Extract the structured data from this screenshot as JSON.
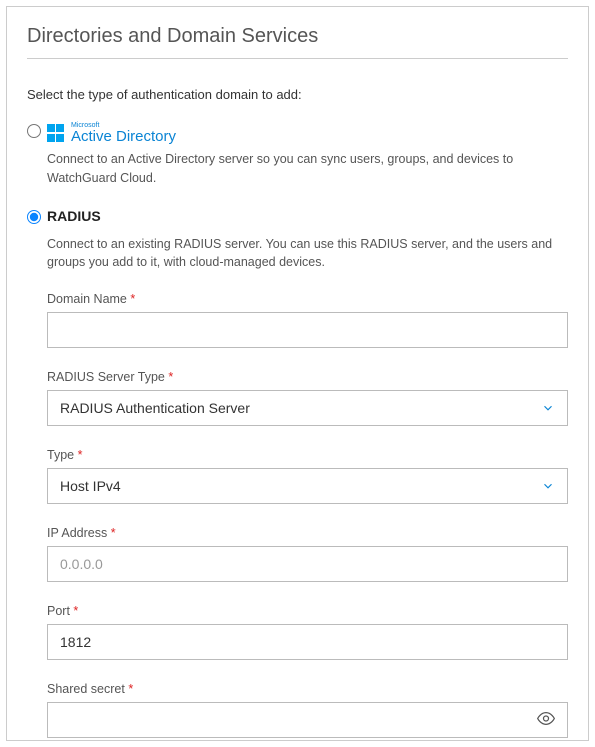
{
  "title": "Directories and Domain Services",
  "intro": "Select the type of authentication domain to add:",
  "ad": {
    "ms": "Microsoft",
    "name": "Active Directory",
    "desc": "Connect to an Active Directory server so you can sync users, groups, and devices to WatchGuard Cloud."
  },
  "radius": {
    "name": "RADIUS",
    "desc": "Connect to an existing RADIUS server. You can use this RADIUS server, and the users and groups you add to it, with cloud-managed devices.",
    "fields": {
      "domainName": {
        "label": "Domain Name",
        "value": ""
      },
      "serverType": {
        "label": "RADIUS Server Type",
        "value": "RADIUS Authentication Server"
      },
      "addrType": {
        "label": "Type",
        "value": "Host IPv4"
      },
      "ip": {
        "label": "IP Address",
        "placeholder": "0.0.0.0",
        "value": ""
      },
      "port": {
        "label": "Port",
        "value": "1812"
      },
      "secret": {
        "label": "Shared secret",
        "value": ""
      }
    }
  },
  "requiredMark": "*"
}
